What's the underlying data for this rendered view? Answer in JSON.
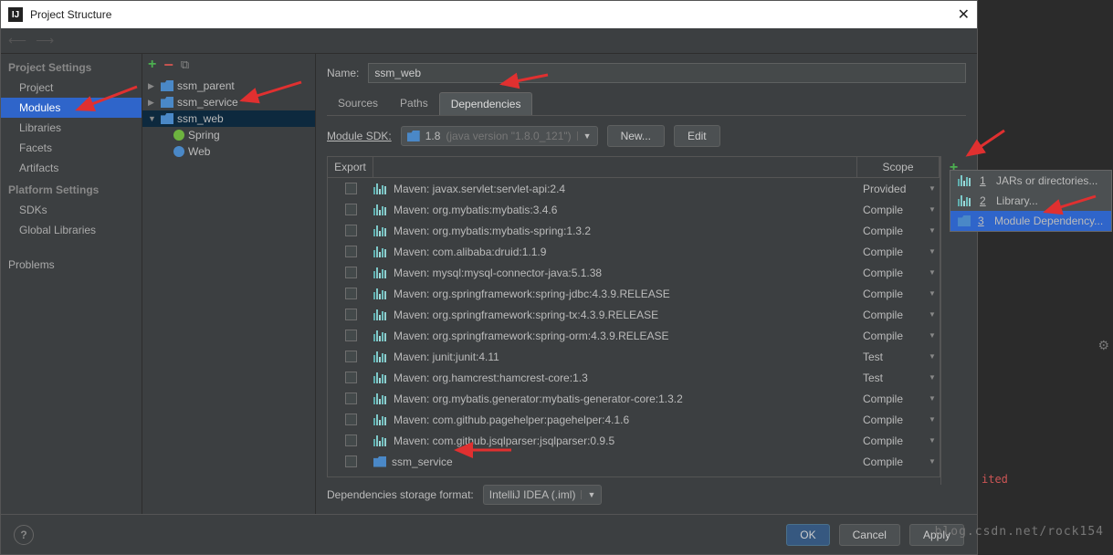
{
  "window": {
    "title": "Project Structure",
    "close": "✕"
  },
  "left": {
    "projectSettings": "Project Settings",
    "platformSettings": "Platform Settings",
    "items": {
      "project": "Project",
      "modules": "Modules",
      "libraries": "Libraries",
      "facets": "Facets",
      "artifacts": "Artifacts",
      "sdks": "SDKs",
      "globalLibs": "Global Libraries",
      "problems": "Problems"
    }
  },
  "tree": {
    "parent": "ssm_parent",
    "service": "ssm_service",
    "web": "ssm_web",
    "spring": "Spring",
    "webfacet": "Web"
  },
  "name": {
    "label": "Name:",
    "value": "ssm_web"
  },
  "tabs": {
    "sources": "Sources",
    "paths": "Paths",
    "deps": "Dependencies"
  },
  "sdk": {
    "label": "Module SDK:",
    "value": "1.8",
    "detail": "(java version \"1.8.0_121\")",
    "new": "New...",
    "edit": "Edit"
  },
  "cols": {
    "export": "Export",
    "scope": "Scope"
  },
  "deps": [
    {
      "name": "Maven: javax.servlet:servlet-api:2.4",
      "scope": "Provided",
      "icon": "lib"
    },
    {
      "name": "Maven: org.mybatis:mybatis:3.4.6",
      "scope": "Compile",
      "icon": "lib"
    },
    {
      "name": "Maven: org.mybatis:mybatis-spring:1.3.2",
      "scope": "Compile",
      "icon": "lib"
    },
    {
      "name": "Maven: com.alibaba:druid:1.1.9",
      "scope": "Compile",
      "icon": "lib"
    },
    {
      "name": "Maven: mysql:mysql-connector-java:5.1.38",
      "scope": "Compile",
      "icon": "lib"
    },
    {
      "name": "Maven: org.springframework:spring-jdbc:4.3.9.RELEASE",
      "scope": "Compile",
      "icon": "lib"
    },
    {
      "name": "Maven: org.springframework:spring-tx:4.3.9.RELEASE",
      "scope": "Compile",
      "icon": "lib"
    },
    {
      "name": "Maven: org.springframework:spring-orm:4.3.9.RELEASE",
      "scope": "Compile",
      "icon": "lib"
    },
    {
      "name": "Maven: junit:junit:4.11",
      "scope": "Test",
      "icon": "lib"
    },
    {
      "name": "Maven: org.hamcrest:hamcrest-core:1.3",
      "scope": "Test",
      "icon": "lib"
    },
    {
      "name": "Maven: org.mybatis.generator:mybatis-generator-core:1.3.2",
      "scope": "Compile",
      "icon": "lib"
    },
    {
      "name": "Maven: com.github.pagehelper:pagehelper:4.1.6",
      "scope": "Compile",
      "icon": "lib"
    },
    {
      "name": "Maven: com.github.jsqlparser:jsqlparser:0.9.5",
      "scope": "Compile",
      "icon": "lib"
    },
    {
      "name": "ssm_service",
      "scope": "Compile",
      "icon": "mod"
    }
  ],
  "fmt": {
    "label": "Dependencies storage format:",
    "value": "IntelliJ IDEA (.iml)"
  },
  "footer": {
    "ok": "OK",
    "cancel": "Cancel",
    "apply": "Apply"
  },
  "popup": {
    "i1": "JARs or directories...",
    "i2": "Library...",
    "i3": "Module Dependency..."
  },
  "bg": {
    "ited": "ited",
    "watermark": "blog.csdn.net/rock154"
  }
}
